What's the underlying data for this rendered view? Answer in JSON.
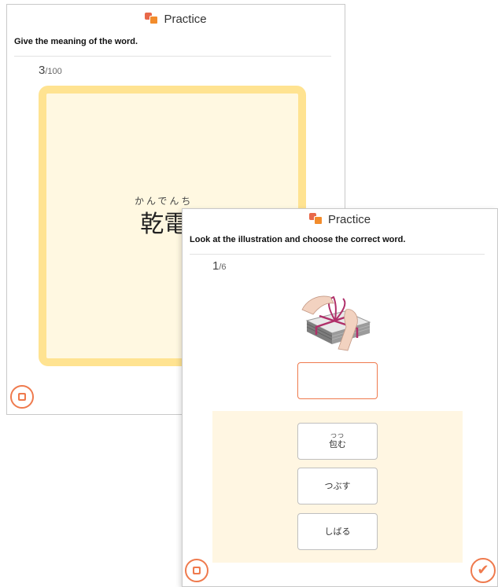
{
  "card_a": {
    "header_title": "Practice",
    "instruction": "Give the meaning of the word.",
    "counter_current": "3",
    "counter_total": "/100",
    "furigana": "かんでんち",
    "word": "乾電"
  },
  "card_b": {
    "header_title": "Practice",
    "instruction": "Look at the illustration and choose the correct word.",
    "counter_current": "1",
    "counter_total": "/6",
    "illustration_icon": "wrapping-package-illustration",
    "choices": [
      {
        "ruby": "つつ",
        "label": "包む"
      },
      {
        "ruby": "",
        "label": "つぶす"
      },
      {
        "ruby": "",
        "label": "しばる"
      }
    ]
  },
  "colors": {
    "accent": "#ef7a4d",
    "flashcard_border": "#ffe391",
    "flashcard_bg": "#fff8e1",
    "choices_bg": "#fff6e2"
  }
}
